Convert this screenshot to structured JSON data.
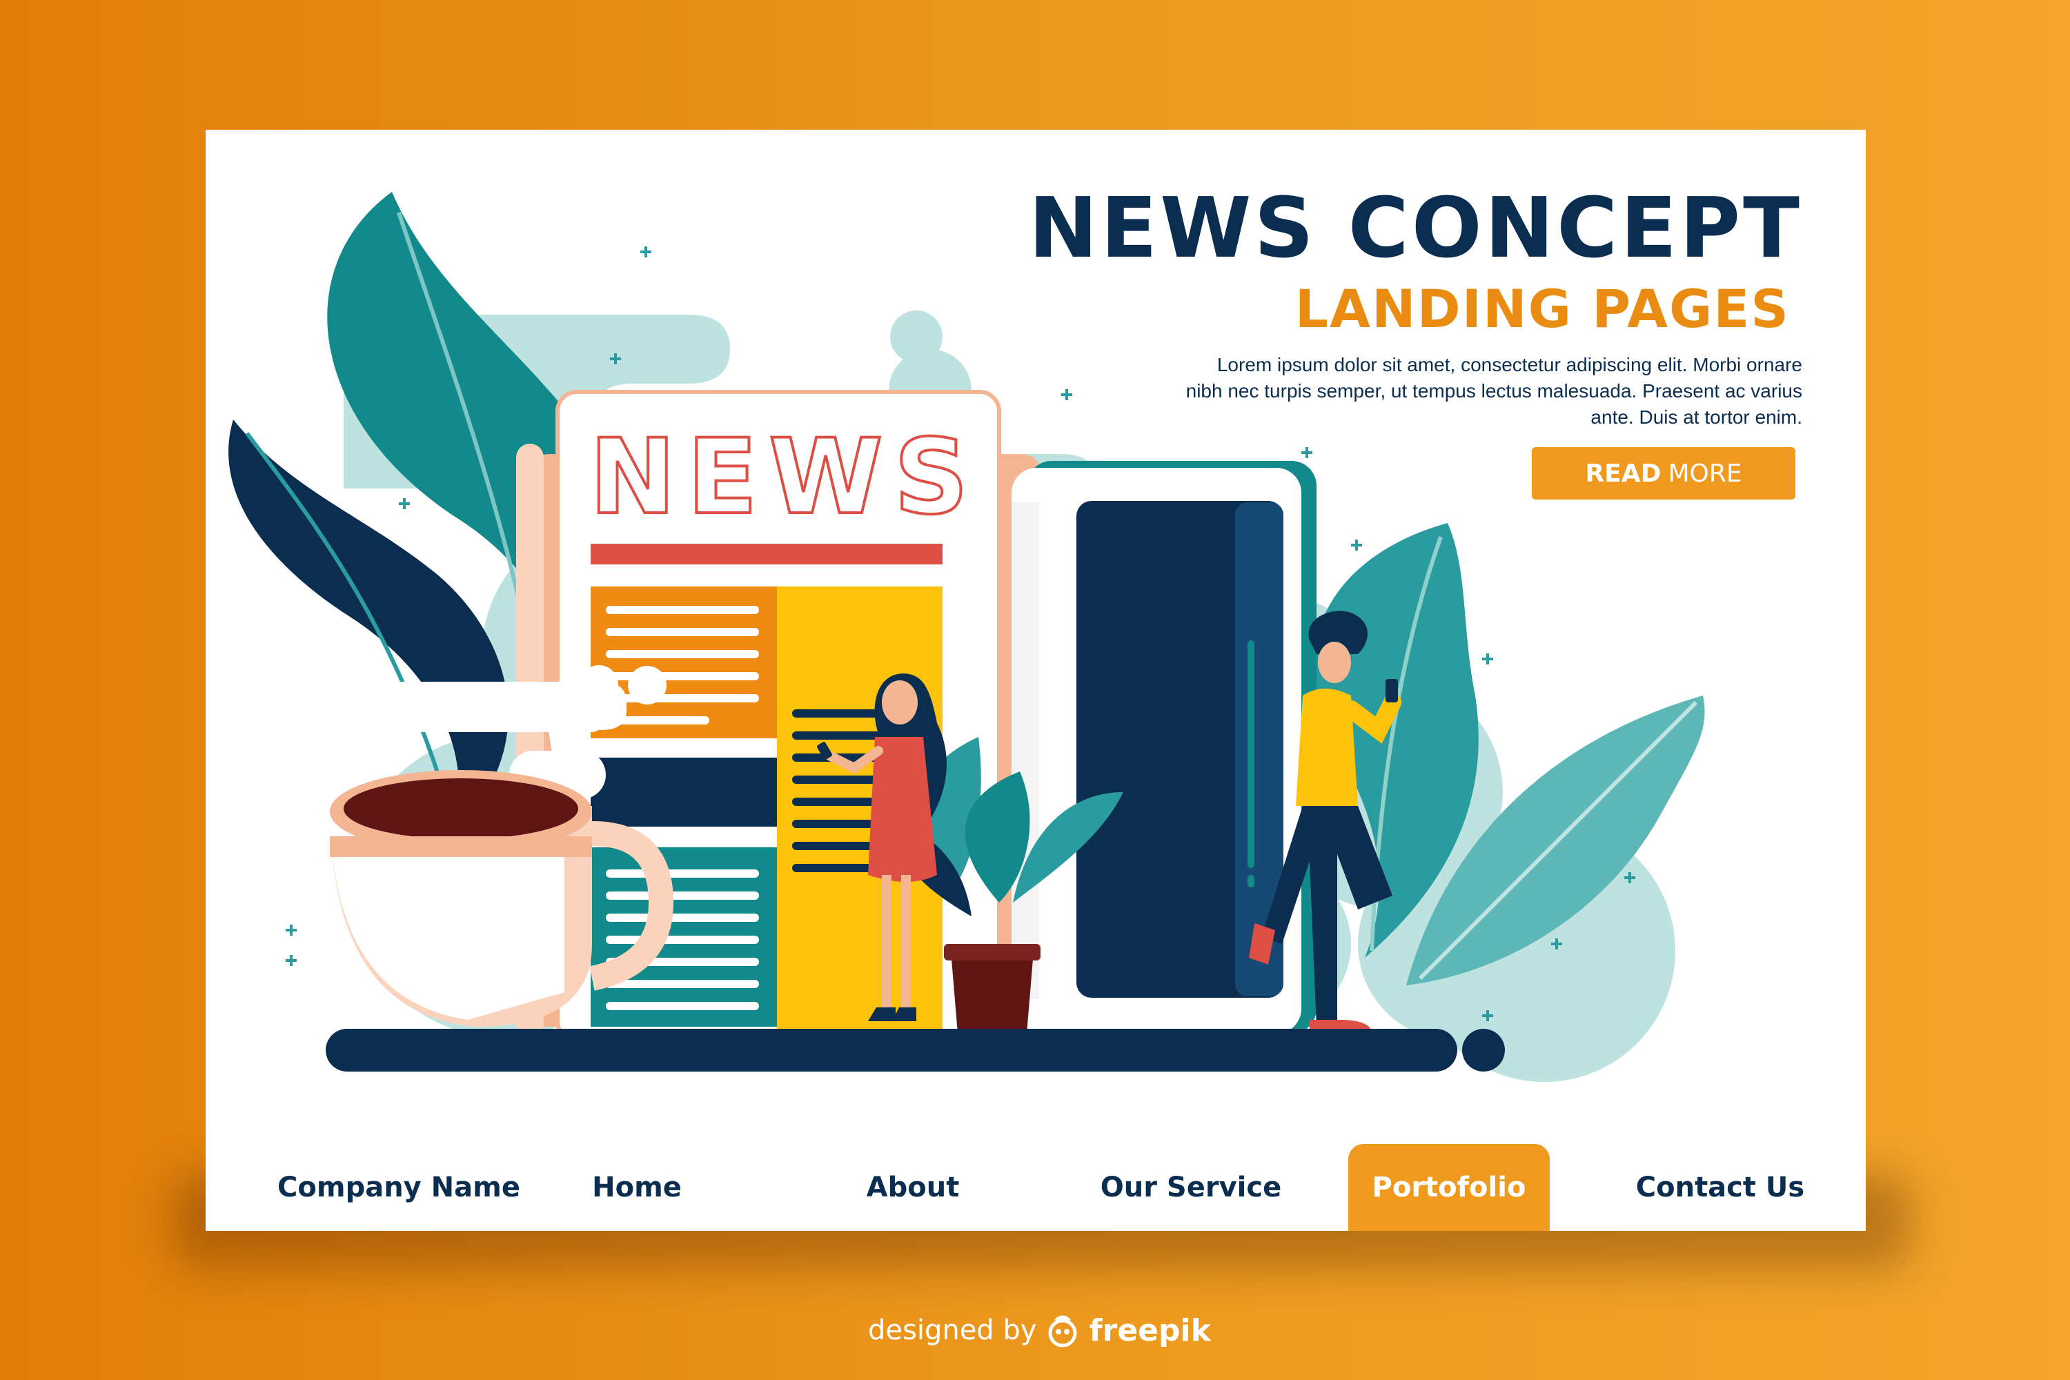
{
  "hero": {
    "title": "NEWS CONCEPT",
    "subtitle": "LANDING PAGES",
    "body": "Lorem ipsum dolor sit amet, consectetur adipiscing elit. Morbi ornare nibh nec turpis semper, ut tempus lectus malesuada. Praesent ac varius ante. Duis at tortor enim.",
    "button_bold": "READ",
    "button_light": "MORE"
  },
  "illustration": {
    "newspaper_headline": "NEWS"
  },
  "nav": {
    "brand": "Company Name",
    "items": [
      {
        "label": "Home"
      },
      {
        "label": "About"
      },
      {
        "label": "Our Service"
      },
      {
        "label": "Portofolio",
        "active": true
      },
      {
        "label": "Contact Us"
      }
    ]
  },
  "credit": {
    "prefix": "designed by",
    "brand": "freepik"
  },
  "colors": {
    "background_orange": "#ec9a1f",
    "navy": "#0b2d50",
    "accent_orange": "#ef9a1e",
    "teal": "#128a8c",
    "light_teal": "#a9d8d9",
    "yellow": "#fcc30a",
    "red": "#dd4f45",
    "peach": "#f4b593"
  }
}
